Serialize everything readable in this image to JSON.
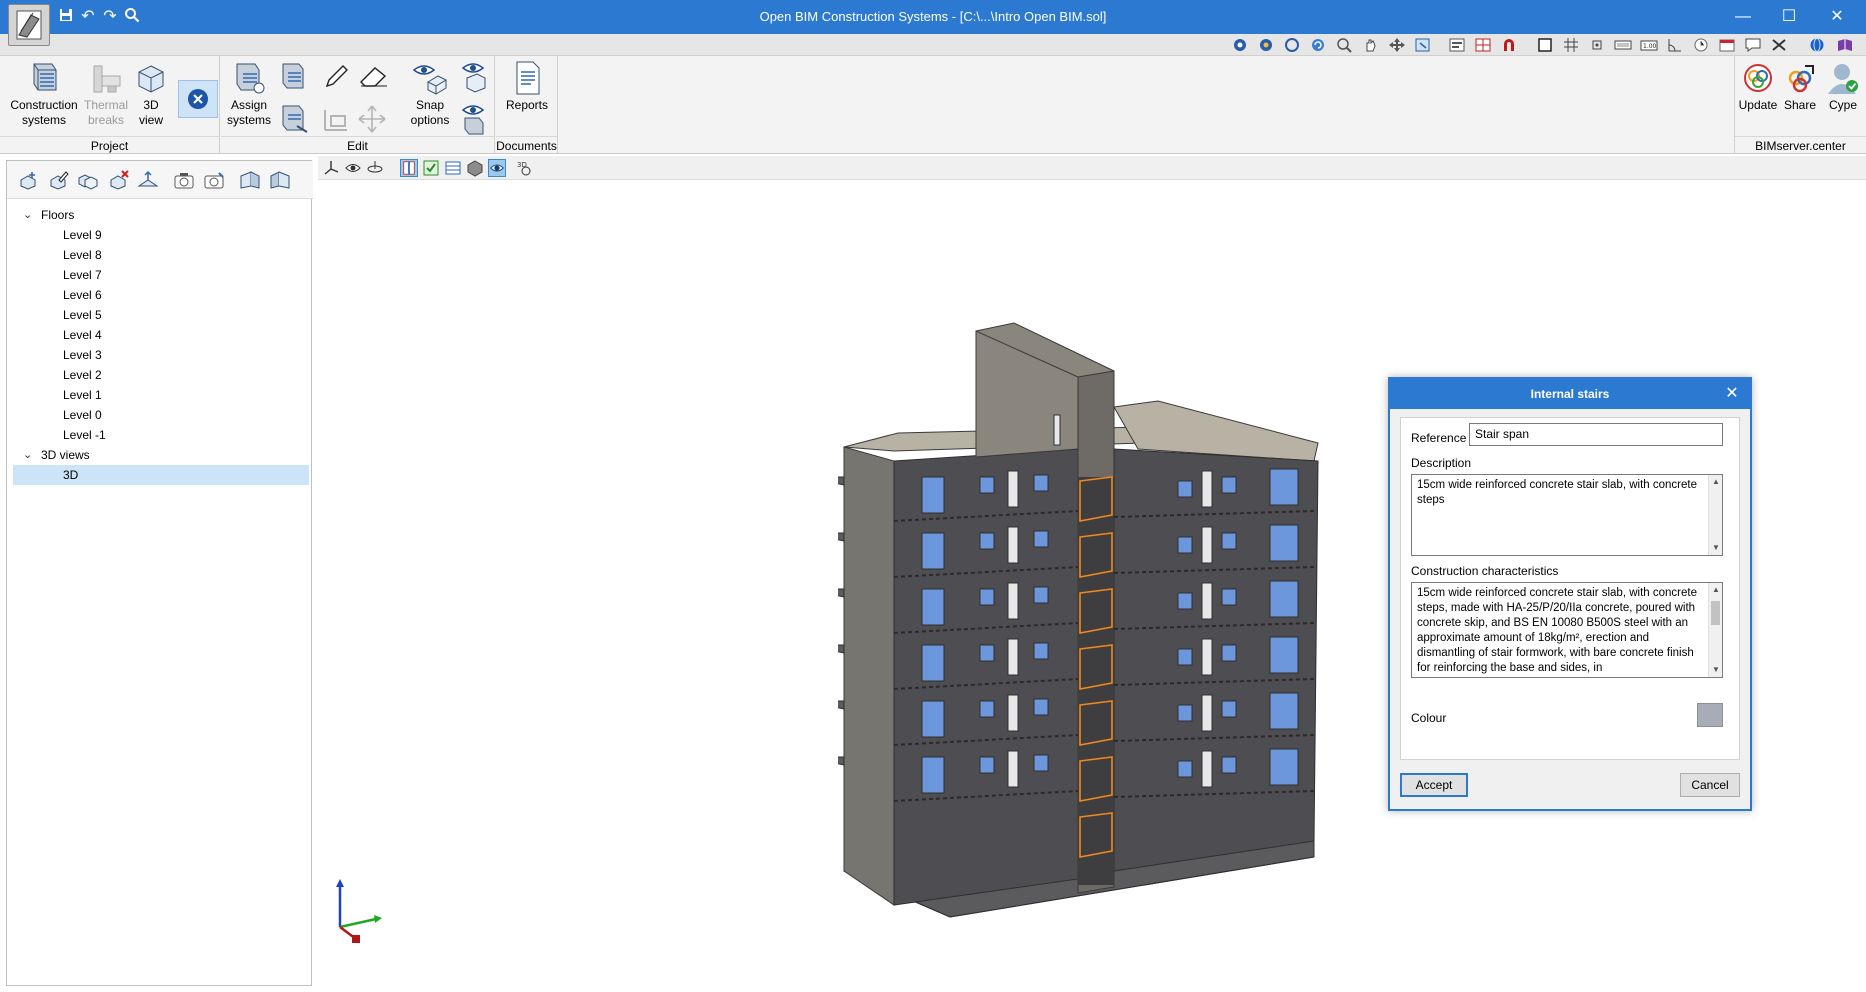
{
  "window": {
    "title": "Open BIM Construction Systems - [C:\\...\\Intro Open BIM.sol]",
    "quick_access": [
      "save-icon",
      "undo-icon",
      "redo-icon",
      "search-icon"
    ]
  },
  "ribbon": {
    "groups": {
      "project": "Project",
      "edit": "Edit",
      "documents": "Documents",
      "bimserver": "BIMserver.center"
    },
    "buttons": {
      "construction_systems": "Construction\nsystems",
      "thermal_breaks": "Thermal\nbreaks",
      "view_3d": "3D\nview",
      "assign_systems": "Assign\nsystems",
      "snap_options": "Snap\noptions",
      "reports": "Reports",
      "update": "Update",
      "share": "Share",
      "cype": "Cype"
    }
  },
  "tree": {
    "floors_label": "Floors",
    "floors": [
      "Level 9",
      "Level 8",
      "Level 7",
      "Level 6",
      "Level 5",
      "Level 4",
      "Level 3",
      "Level 2",
      "Level 1",
      "Level 0",
      "Level -1"
    ],
    "views_label": "3D views",
    "views": [
      "3D"
    ],
    "selected_view": "3D"
  },
  "dialog": {
    "title": "Internal stairs",
    "reference_label": "Reference",
    "reference_value": "Stair span",
    "description_label": "Description",
    "description_value": "15cm wide reinforced concrete stair slab, with concrete steps",
    "characteristics_label": "Construction characteristics",
    "characteristics_value": "15cm wide reinforced concrete stair slab, with concrete steps, made with HA-25/P/20/IIa concrete, poured with concrete skip, and BS EN 10080 B500S steel with an approximate amount of 18kg/m², erection and dismantling of stair formwork, with bare concrete finish for reinforcing the base and sides, in",
    "colour_label": "Colour",
    "colour_value": "#a6adb6",
    "accept_label": "Accept",
    "cancel_label": "Cancel"
  },
  "colors": {
    "accent": "#2b79d0",
    "selection": "#cce4f7",
    "stair_highlight": "#f08a1c",
    "wall": "#6e6e70",
    "window": "#6d97dc"
  }
}
